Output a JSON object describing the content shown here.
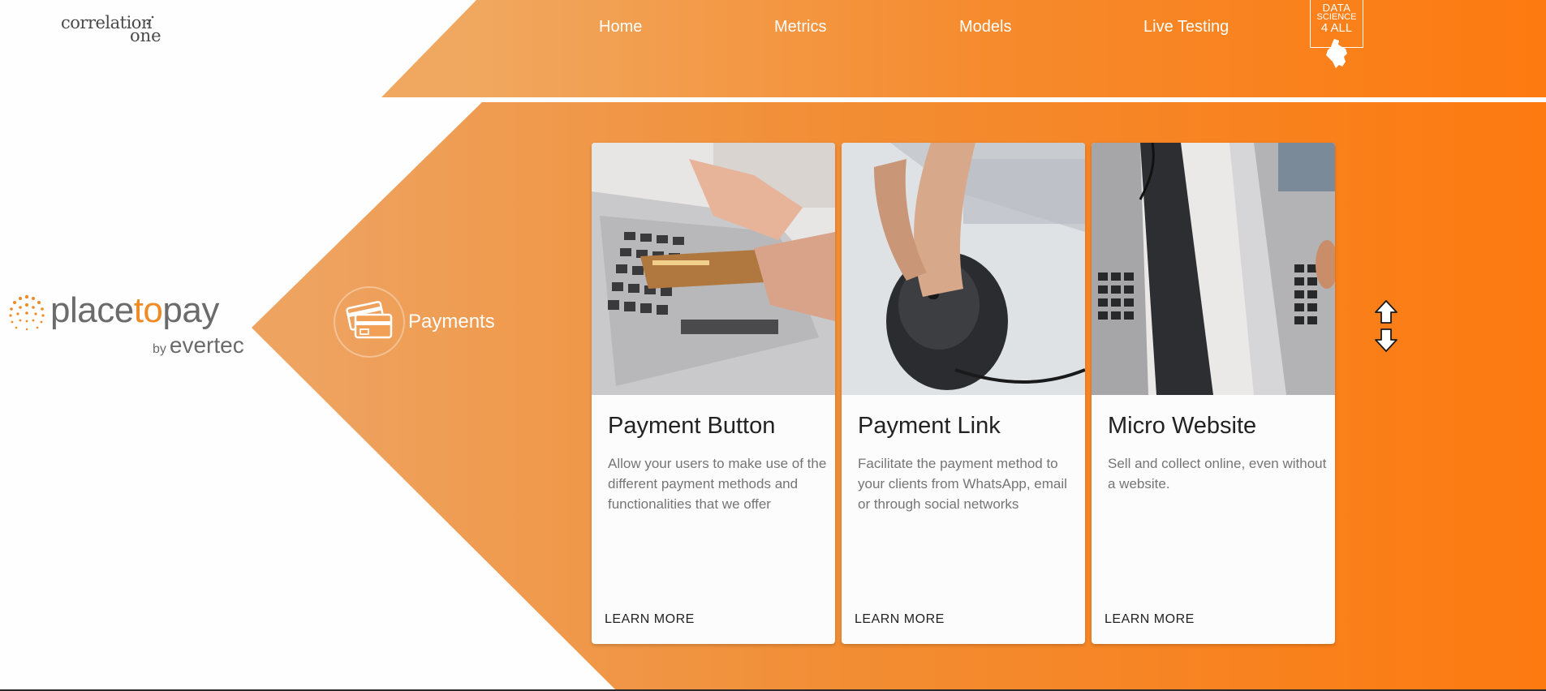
{
  "header": {
    "brand": {
      "line1": "correlation",
      "line2": "one"
    },
    "nav": [
      {
        "label": "Home"
      },
      {
        "label": "Metrics"
      },
      {
        "label": "Models"
      },
      {
        "label": "Live Testing"
      }
    ],
    "badge": {
      "line1": "DATA",
      "line2": "SCIENCE",
      "line3": "4 ALL"
    }
  },
  "sidebar_logo": {
    "part1": "place",
    "part2": "to",
    "part3": "pay",
    "by": "by",
    "company": "evertec"
  },
  "section": {
    "icon": "credit-cards-icon",
    "label": "Payments"
  },
  "cards": [
    {
      "title": "Payment Button",
      "description": "Allow your users to make use of the different payment methods and functionalities that we offer",
      "link": "LEARN MORE"
    },
    {
      "title": "Payment Link",
      "description": "Facilitate the payment method to your clients from WhatsApp, email or through social networks",
      "link": "LEARN MORE"
    },
    {
      "title": "Micro Website",
      "description": "Sell and collect online, even without a website.",
      "link": "LEARN MORE"
    }
  ],
  "colors": {
    "accent": "#f68a2c",
    "accent_dark": "#fd7a10",
    "card_bg": "#fcfcfc"
  },
  "icons": [
    "colombia-map-icon",
    "credit-cards-icon",
    "scroll-up-down-icon"
  ]
}
